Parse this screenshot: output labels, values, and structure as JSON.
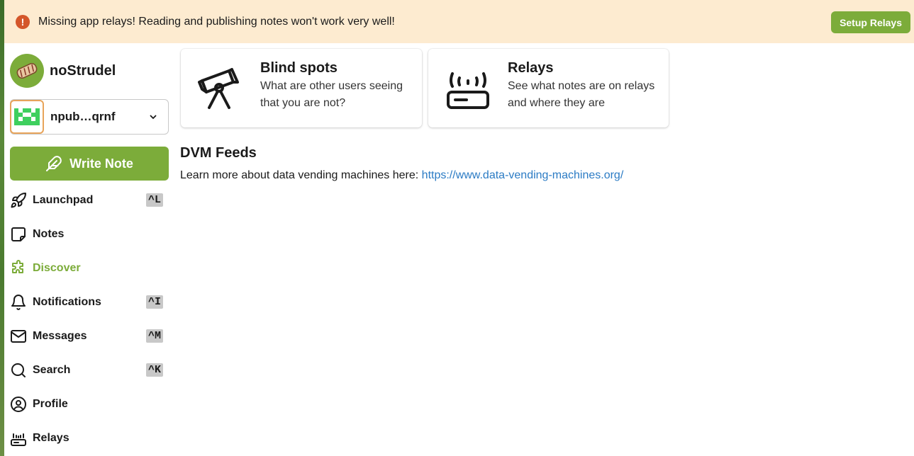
{
  "banner": {
    "message": "Missing app relays! Reading and publishing notes won't work very well!",
    "button": "Setup Relays",
    "icon": "alert-circle-icon"
  },
  "brand": {
    "name": "noStrudel"
  },
  "account": {
    "npub": "npub…qrnf"
  },
  "write_note": {
    "label": "Write Note"
  },
  "nav": [
    {
      "label": "Launchpad",
      "icon": "rocket-icon",
      "shortcut": "^L"
    },
    {
      "label": "Notes",
      "icon": "note-icon",
      "shortcut": ""
    },
    {
      "label": "Discover",
      "icon": "puzzle-icon",
      "shortcut": "",
      "active": true
    },
    {
      "label": "Notifications",
      "icon": "bell-icon",
      "shortcut": "^I"
    },
    {
      "label": "Messages",
      "icon": "mail-icon",
      "shortcut": "^M"
    },
    {
      "label": "Search",
      "icon": "search-icon",
      "shortcut": "^K"
    },
    {
      "label": "Profile",
      "icon": "user-circle-icon",
      "shortcut": ""
    },
    {
      "label": "Relays",
      "icon": "router-icon",
      "shortcut": ""
    }
  ],
  "cards": [
    {
      "title": "Blind spots",
      "desc_line1": "What are other users seeing",
      "desc_line2": "that you are not?",
      "icon": "telescope-icon"
    },
    {
      "title": "Relays",
      "desc_line1": "See what notes are on relays",
      "desc_line2": "and where they are",
      "icon": "router-icon"
    }
  ],
  "dvm": {
    "heading": "DVM Feeds",
    "text": "Learn more about data vending machines here: ",
    "link": "https://www.data-vending-machines.org/"
  },
  "colors": {
    "accent": "#7cac3a",
    "banner_bg": "#fdebd0",
    "warn": "#d4562a",
    "link": "#2b7bc4"
  }
}
